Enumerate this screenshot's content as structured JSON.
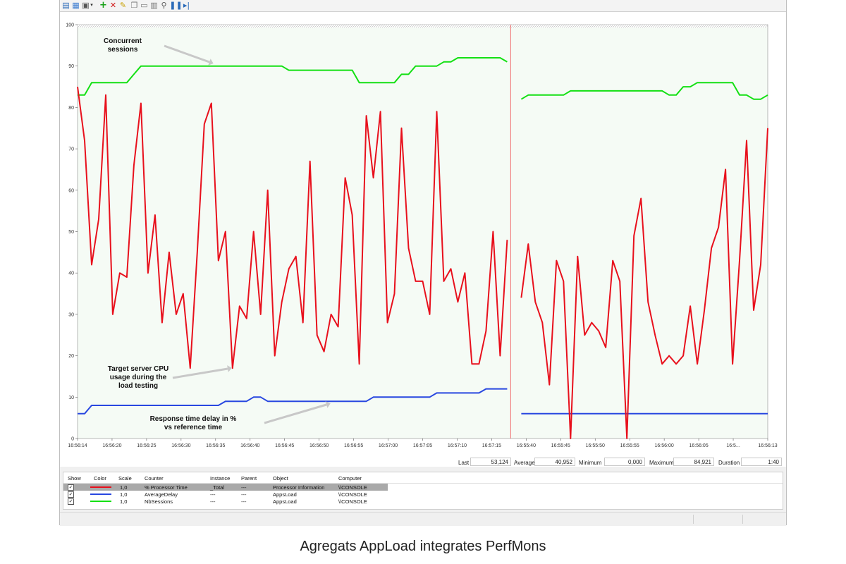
{
  "toolbar": {
    "icons": [
      "view-graph-icon",
      "view-history-icon",
      "view-report-icon",
      "dropdown-icon",
      "add-counter-icon",
      "delete-counter-icon",
      "highlight-icon",
      "copy-properties-icon",
      "paste-counter-list-icon",
      "properties-icon",
      "zoom-icon",
      "freeze-display-icon",
      "update-data-icon"
    ]
  },
  "chart_data": {
    "type": "line",
    "ylim": [
      0,
      100
    ],
    "yticks": [
      0,
      10,
      20,
      30,
      40,
      50,
      60,
      70,
      80,
      90,
      100
    ],
    "xtick_labels": [
      "16:56:14",
      "16:56:20",
      "16:56:25",
      "16:56:30",
      "16:56:35",
      "16:56:40",
      "16:56:45",
      "16:56:50",
      "16:56:55",
      "16:57:00",
      "16:57:05",
      "16:57:10",
      "16:57:15",
      "16:55:40",
      "16:55:45",
      "16:55:50",
      "16:55:55",
      "16:56:00",
      "16:56:05",
      "16:5...",
      "16:56:13"
    ],
    "current_position_index": 61,
    "series": [
      {
        "name": "% Processor Time",
        "color": "#e8101c",
        "values": [
          85,
          72,
          42,
          53,
          83,
          30,
          40,
          39,
          66,
          81,
          40,
          54,
          28,
          45,
          30,
          35,
          17,
          45,
          76,
          81,
          43,
          50,
          17,
          32,
          29,
          50,
          30,
          60,
          20,
          33,
          41,
          44,
          28,
          67,
          25,
          21,
          30,
          27,
          63,
          54,
          18,
          78,
          63,
          79,
          28,
          35,
          75,
          46,
          38,
          38,
          30,
          79,
          38,
          41,
          33,
          40,
          18,
          18,
          26,
          50,
          20,
          48,
          53,
          34,
          47,
          33,
          28,
          13,
          43,
          38,
          0,
          44,
          25,
          28,
          26,
          22,
          43,
          38,
          0,
          49,
          58,
          33,
          25,
          18,
          20,
          18,
          20,
          32,
          18,
          31,
          46,
          51,
          65,
          18,
          43,
          72,
          31,
          42,
          75
        ]
      },
      {
        "name": "NbSessions",
        "color": "#13e013",
        "values": [
          83,
          83,
          86,
          86,
          86,
          86,
          86,
          86,
          88,
          90,
          90,
          90,
          90,
          90,
          90,
          90,
          90,
          90,
          90,
          90,
          90,
          90,
          90,
          90,
          90,
          90,
          90,
          90,
          90,
          90,
          89,
          89,
          89,
          89,
          89,
          89,
          89,
          89,
          89,
          89,
          86,
          86,
          86,
          86,
          86,
          86,
          88,
          88,
          90,
          90,
          90,
          90,
          91,
          91,
          92,
          92,
          92,
          92,
          92,
          92,
          92,
          91,
          91,
          82,
          83,
          83,
          83,
          83,
          83,
          83,
          84,
          84,
          84,
          84,
          84,
          84,
          84,
          84,
          84,
          84,
          84,
          84,
          84,
          84,
          83,
          83,
          85,
          85,
          86,
          86,
          86,
          86,
          86,
          86,
          83,
          83,
          82,
          82,
          83
        ]
      },
      {
        "name": "AverageDelay",
        "color": "#2847e0",
        "values": [
          6,
          6,
          8,
          8,
          8,
          8,
          8,
          8,
          8,
          8,
          8,
          8,
          8,
          8,
          8,
          8,
          8,
          8,
          8,
          8,
          8,
          9,
          9,
          9,
          9,
          10,
          10,
          9,
          9,
          9,
          9,
          9,
          9,
          9,
          9,
          9,
          9,
          9,
          9,
          9,
          9,
          9,
          10,
          10,
          10,
          10,
          10,
          10,
          10,
          10,
          10,
          11,
          11,
          11,
          11,
          11,
          11,
          11,
          12,
          12,
          12,
          12,
          12,
          6,
          6,
          6,
          6,
          6,
          6,
          6,
          6,
          6,
          6,
          6,
          6,
          6,
          6,
          6,
          6,
          6,
          6,
          6,
          6,
          6,
          6,
          6,
          6,
          6,
          6,
          6,
          6,
          6,
          6,
          6,
          6,
          6,
          6,
          6,
          6
        ]
      }
    ],
    "annotations": [
      {
        "text": "Concurrent sessions",
        "lines": [
          "Concurrent",
          "sessions"
        ]
      },
      {
        "text": "Target server CPU usage during the load testing",
        "lines": [
          "Target server CPU",
          "usage during the",
          "load testing"
        ]
      },
      {
        "text": "Response time delay in % vs reference time",
        "lines": [
          "Response time delay in %",
          "vs reference time"
        ]
      }
    ]
  },
  "summary": {
    "last_label": "Last",
    "last_value": "53,124",
    "average_label": "Average",
    "average_value": "40,952",
    "minimum_label": "Minimum",
    "minimum_value": "0,000",
    "maximum_label": "Maximum",
    "maximum_value": "84,921",
    "duration_label": "Duration",
    "duration_value": "1:40"
  },
  "legend": {
    "headers": [
      "Show",
      "Color",
      "Scale",
      "Counter",
      "Instance",
      "Parent",
      "Object",
      "Computer"
    ],
    "rows": [
      {
        "show": "✓",
        "color": "#e8101c",
        "scale": "1,0",
        "counter": "% Processor Time",
        "instance": "_Total",
        "parent": "---",
        "object": "Processor Information",
        "computer": "\\\\CONSOLE",
        "selected": true
      },
      {
        "show": "✓",
        "color": "#2847e0",
        "scale": "1,0",
        "counter": "AverageDelay",
        "instance": "---",
        "parent": "---",
        "object": "AppsLoad",
        "computer": "\\\\CONSOLE",
        "selected": false
      },
      {
        "show": "✓",
        "color": "#13e013",
        "scale": "1,0",
        "counter": "NbSessions",
        "instance": "---",
        "parent": "---",
        "object": "AppsLoad",
        "computer": "\\\\CONSOLE",
        "selected": false
      }
    ]
  },
  "caption": "Agregats AppLoad integrates PerfMons"
}
